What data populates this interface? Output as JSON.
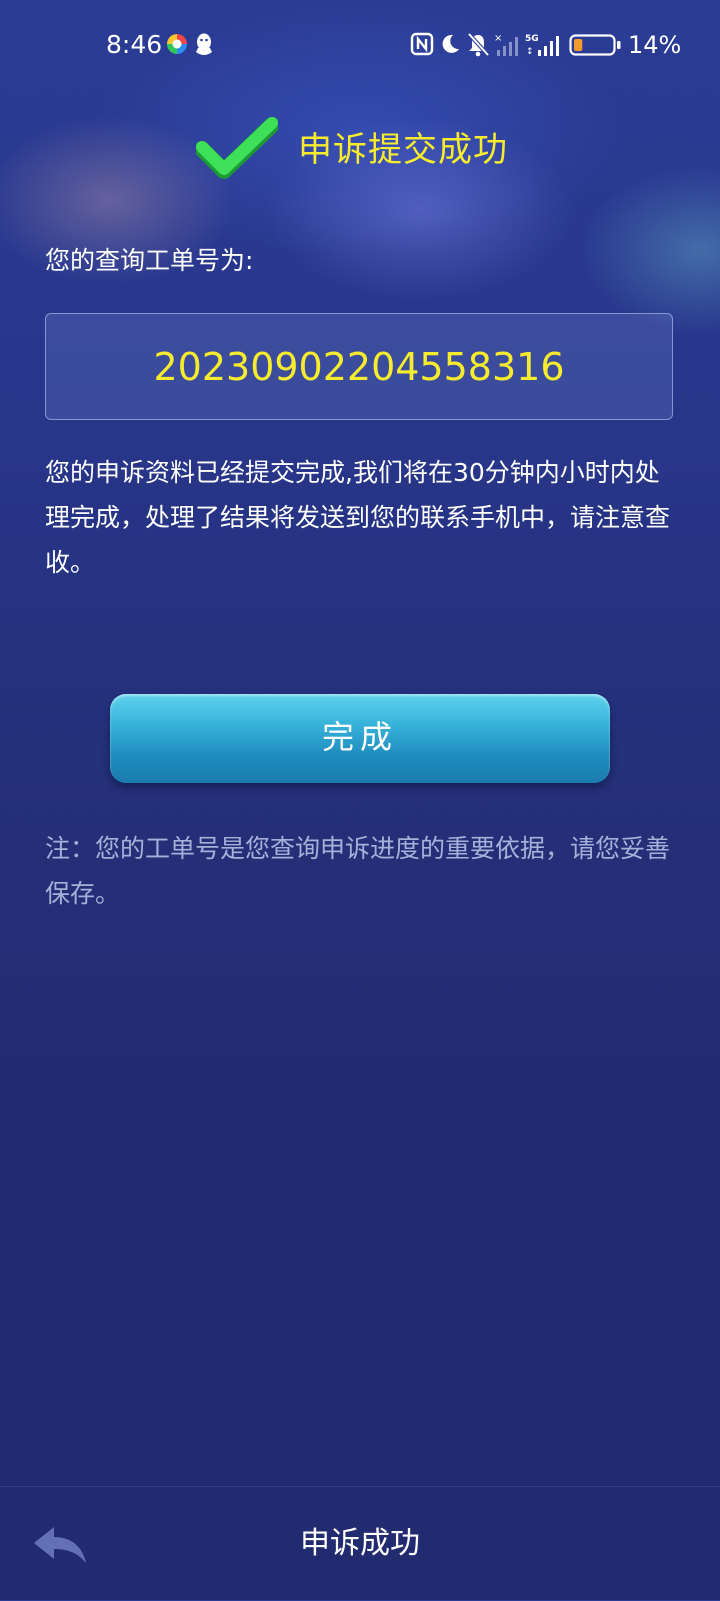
{
  "status_bar": {
    "time": "8:46",
    "battery_percent": "14%",
    "battery_level": 0.14,
    "icons": [
      "app-logo-icon",
      "qq-icon",
      "nfc-icon",
      "moon-icon",
      "bell-muted-icon",
      "signal-no-sim-icon",
      "signal-5g-icon",
      "battery-icon"
    ]
  },
  "header": {
    "icon": "check-icon",
    "title": "申诉提交成功"
  },
  "ticket": {
    "label": "您的查询工单号为:",
    "number": "20230902204558316"
  },
  "message": "您的申诉资料已经提交完成,我们将在30分钟内小时内处理完成，处理了结果将发送到您的联系手机中，请注意查收。",
  "done_button": {
    "label": "完成"
  },
  "note": "注：您的工单号是您查询申诉进度的重要依据，请您妥善保存。",
  "bottom_bar": {
    "back_icon": "back-arrow-icon",
    "title": "申诉成功"
  },
  "colors": {
    "accent_yellow": "#f6ec2d",
    "check_green": "#2fd84a",
    "button_blue": "#36b2da",
    "note_gray": "#a7b0d8",
    "background": "#232d74"
  }
}
